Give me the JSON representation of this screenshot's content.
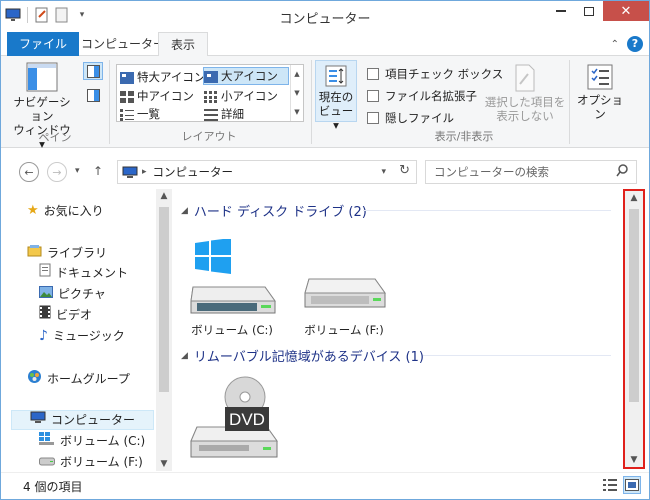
{
  "window": {
    "title": "コンピューター"
  },
  "tabs": {
    "file": "ファイル",
    "computer": "コンピューター",
    "view": "表示"
  },
  "ribbon": {
    "pane_group": {
      "nav_pane_line1": "ナビゲーション",
      "nav_pane_line2": "ウィンドウ ▾",
      "label": "ペイン"
    },
    "layout_group": {
      "items": [
        "特大アイコン",
        "大アイコン",
        "中アイコン",
        "小アイコン",
        "一覧",
        "詳細"
      ],
      "selected": "大アイコン",
      "label": "レイアウト"
    },
    "current_view": {
      "line1": "現在の",
      "line2": "ビュー ▾"
    },
    "show_hide": {
      "checkboxes": [
        "項目チェック ボックス",
        "ファイル名拡張子",
        "隠しファイル"
      ],
      "hide_selected_line1": "選択した項目を",
      "hide_selected_line2": "表示しない",
      "label": "表示/非表示"
    },
    "options": "オプション"
  },
  "address": {
    "path": "コンピューター",
    "search_placeholder": "コンピューターの検索"
  },
  "nav_pane": {
    "favorites": "お気に入り",
    "libraries": "ライブラリ",
    "library_items": [
      "ドキュメント",
      "ピクチャ",
      "ビデオ",
      "ミュージック"
    ],
    "homegroup": "ホームグループ",
    "computer": "コンピューター",
    "computer_items": [
      "ボリューム (C:)",
      "ボリューム (F:)"
    ]
  },
  "content": {
    "hdd_section": "ハード ディスク ドライブ (2)",
    "drives": [
      "ボリューム (C:)",
      "ボリューム (F:)"
    ],
    "removable_section": "リムーバブル記憶域があるデバイス (1)",
    "dvd_badge": "DVD"
  },
  "status": {
    "item_count": "4 個の項目"
  },
  "colors": {
    "accent": "#1979ca",
    "highlight_border": "#e0201b",
    "section_text": "#1e3287"
  }
}
